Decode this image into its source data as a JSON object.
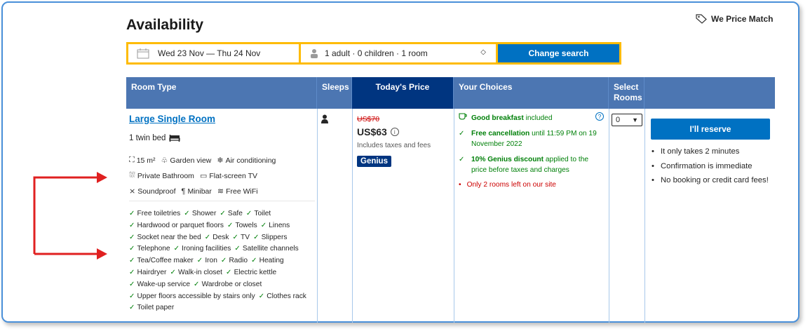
{
  "header": {
    "title": "Availability",
    "price_match": "We Price Match"
  },
  "search": {
    "dates": "Wed 23 Nov — Thu 24 Nov",
    "occupancy": "1 adult · 0 children · 1 room",
    "button": "Change search"
  },
  "table": {
    "headers": {
      "room_type": "Room Type",
      "sleeps": "Sleeps",
      "price": "Today's Price",
      "choices": "Your Choices",
      "select_line1": "Select",
      "select_line2": "Rooms"
    }
  },
  "room": {
    "name": "Large Single Room",
    "bed": "1 twin bed",
    "size": "15 m²",
    "facilities_row1": [
      "Garden view",
      "Air conditioning"
    ],
    "facilities_row2": [
      "Private Bathroom",
      "Flat-screen TV"
    ],
    "facilities_row3": [
      "Soundproof",
      "Minibar",
      "Free WiFi"
    ],
    "amenities": [
      [
        "Free toiletries",
        "Shower",
        "Safe",
        "Toilet"
      ],
      [
        "Hardwood or parquet floors",
        "Towels",
        "Linens"
      ],
      [
        "Socket near the bed",
        "Desk",
        "TV",
        "Slippers"
      ],
      [
        "Telephone",
        "Ironing facilities",
        "Satellite channels"
      ],
      [
        "Tea/Coffee maker",
        "Iron",
        "Radio",
        "Heating"
      ],
      [
        "Hairdryer",
        "Walk-in closet",
        "Electric kettle"
      ],
      [
        "Wake-up service",
        "Wardrobe or closet"
      ],
      [
        "Upper floors accessible by stairs only",
        "Clothes rack"
      ],
      [
        "Toilet paper"
      ]
    ]
  },
  "price": {
    "original": "US$70",
    "current": "US$63",
    "taxes": "Includes taxes and fees",
    "badge": "Genius"
  },
  "choices": {
    "breakfast_bold": "Good breakfast",
    "breakfast_rest": " included",
    "cancel_bold": "Free cancellation",
    "cancel_rest": " until 11:59 PM on 19 November 2022",
    "genius_bold": "10% Genius discount",
    "genius_rest": " applied to the price before taxes and charges",
    "scarcity": "Only 2 rooms left on our site"
  },
  "select": {
    "value": "0"
  },
  "reserve": {
    "button": "I'll reserve",
    "bullets": [
      "It only takes 2 minutes",
      "Confirmation is immediate",
      "No booking or credit card fees!"
    ]
  },
  "colors": {
    "header_blue": "#4c76b2",
    "dark_blue": "#003580",
    "button_blue": "#0071c2",
    "yellow_border": "#febb02",
    "green": "#008009",
    "red": "#cc0000",
    "arrow_red": "#e02020"
  }
}
